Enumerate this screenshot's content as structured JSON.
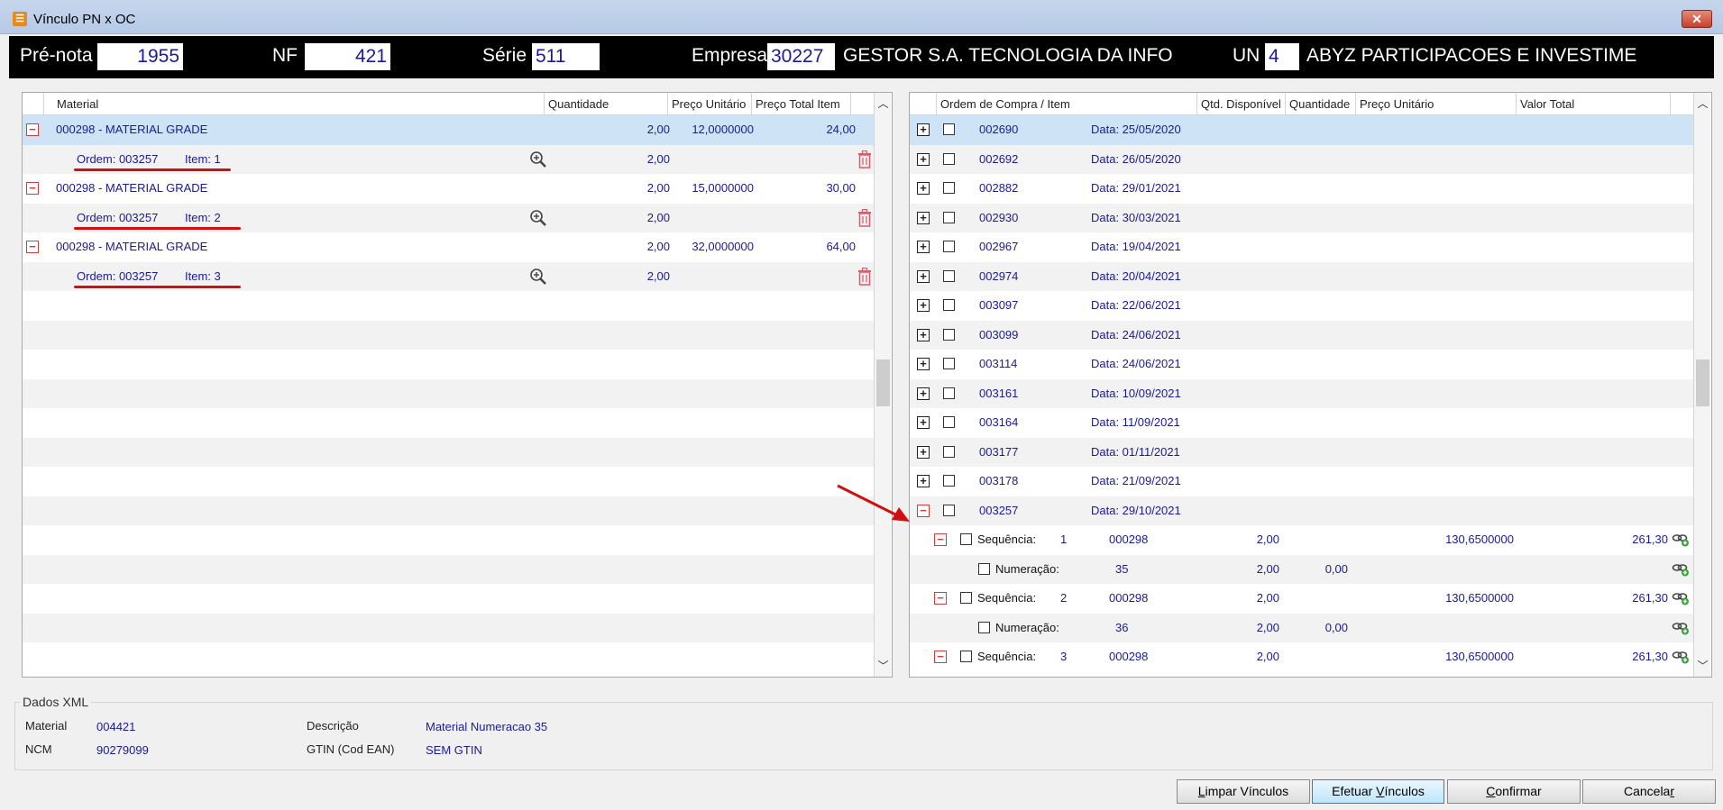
{
  "window": {
    "title": "Vínculo PN x OC",
    "close": "✕"
  },
  "header": {
    "prenota_label": "Pré-nota",
    "prenota_value": "1955",
    "nf_label": "NF",
    "nf_value": "421",
    "serie_label": "Série",
    "serie_value": "511",
    "empresa_label": "Empresa",
    "empresa_code": "30227",
    "empresa_name": "GESTOR S.A. TECNOLOGIA DA INFO",
    "un_label": "UN",
    "un_code": "4",
    "un_name": "ABYZ PARTICIPACOES E INVESTIME"
  },
  "left_grid": {
    "columns": [
      "Material",
      "Quantidade",
      "Preço Unitário",
      "Preço Total Item"
    ],
    "rows": [
      {
        "type": "material",
        "text": "000298 - MATERIAL GRADE",
        "qty": "2,00",
        "unit": "12,0000000",
        "total": "24,00"
      },
      {
        "type": "order",
        "ordem": "Ordem: 003257",
        "item": "Item: 1",
        "qty": "2,00"
      },
      {
        "type": "material",
        "text": "000298 - MATERIAL GRADE",
        "qty": "2,00",
        "unit": "15,0000000",
        "total": "30,00"
      },
      {
        "type": "order",
        "ordem": "Ordem: 003257",
        "item": "Item: 2",
        "qty": "2,00"
      },
      {
        "type": "material",
        "text": "000298 - MATERIAL GRADE",
        "qty": "2,00",
        "unit": "32,0000000",
        "total": "64,00"
      },
      {
        "type": "order",
        "ordem": "Ordem: 003257",
        "item": "Item: 3",
        "qty": "2,00"
      }
    ]
  },
  "right_grid": {
    "columns": [
      "Ordem de Compra / Item",
      "Qtd. Disponível",
      "Quantidade",
      "Preço Unitário",
      "Valor Total"
    ],
    "orders": [
      {
        "num": "002690",
        "date": "Data: 25/05/2020"
      },
      {
        "num": "002692",
        "date": "Data: 26/05/2020"
      },
      {
        "num": "002882",
        "date": "Data: 29/01/2021"
      },
      {
        "num": "002930",
        "date": "Data: 30/03/2021"
      },
      {
        "num": "002967",
        "date": "Data: 19/04/2021"
      },
      {
        "num": "002974",
        "date": "Data: 20/04/2021"
      },
      {
        "num": "003097",
        "date": "Data: 22/06/2021"
      },
      {
        "num": "003099",
        "date": "Data: 24/06/2021"
      },
      {
        "num": "003114",
        "date": "Data: 24/06/2021"
      },
      {
        "num": "003161",
        "date": "Data: 10/09/2021"
      },
      {
        "num": "003164",
        "date": "Data: 11/09/2021"
      },
      {
        "num": "003177",
        "date": "Data: 01/11/2021"
      },
      {
        "num": "003178",
        "date": "Data: 21/09/2021"
      },
      {
        "num": "003257",
        "date": "Data: 29/10/2021"
      }
    ],
    "sub_rows": [
      {
        "type": "seq",
        "label": "Sequência:",
        "n": "1",
        "mat": "000298",
        "disp": "2,00",
        "unit": "130,6500000",
        "total": "261,30"
      },
      {
        "type": "num",
        "label": "Numeração:",
        "n": "35",
        "disp": "2,00",
        "qty": "0,00"
      },
      {
        "type": "seq",
        "label": "Sequência:",
        "n": "2",
        "mat": "000298",
        "disp": "2,00",
        "unit": "130,6500000",
        "total": "261,30"
      },
      {
        "type": "num",
        "label": "Numeração:",
        "n": "36",
        "disp": "2,00",
        "qty": "0,00"
      },
      {
        "type": "seq",
        "label": "Sequência:",
        "n": "3",
        "mat": "000298",
        "disp": "2,00",
        "unit": "130,6500000",
        "total": "261,30"
      }
    ]
  },
  "xml": {
    "title": "Dados XML",
    "material_label": "Material",
    "material_value": "004421",
    "ncm_label": "NCM",
    "ncm_value": "90279099",
    "descricao_label": "Descrição",
    "descricao_value": "Material Numeracao 35",
    "gtin_label": "GTIN (Cod EAN)",
    "gtin_value": "SEM GTIN"
  },
  "buttons": {
    "limpar": {
      "u": "L",
      "rest": "impar Vínculos"
    },
    "efetuar": {
      "pre": "Efetuar ",
      "u": "V",
      "rest": "ínculos"
    },
    "confirmar": {
      "u": "C",
      "rest": "onfirmar"
    },
    "cancelar": {
      "pre": "Cancela",
      "u": "r"
    }
  },
  "colors": {
    "link_blue": "#1a1a9a",
    "selected_row": "#cfe3f7",
    "annotation_red": "#d01010",
    "header_bg": "#000000"
  }
}
